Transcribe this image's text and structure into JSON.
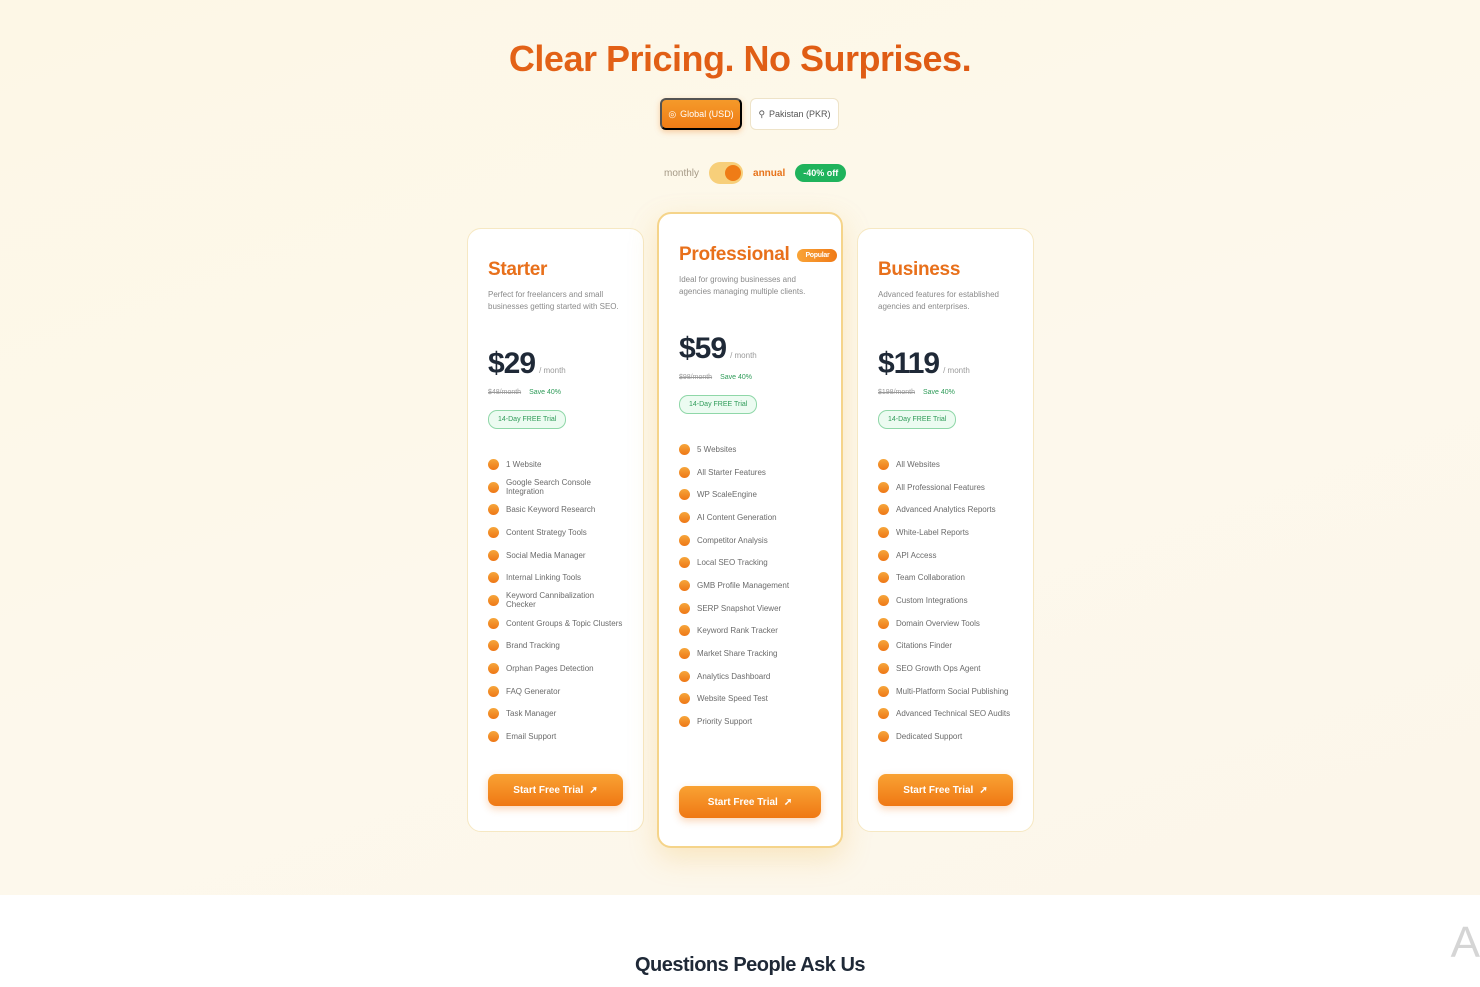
{
  "title": "Clear Pricing. No Surprises.",
  "regions": [
    {
      "label": "Global (USD)",
      "icon": "globe-icon"
    },
    {
      "label": "Pakistan (PKR)",
      "icon": "location-icon"
    }
  ],
  "billing": {
    "monthly": "monthly",
    "annual": "annual",
    "discount": "-40% off",
    "selected": "annual"
  },
  "colors": {
    "accent": "#ef7c16",
    "green": "#1fb35c",
    "title": "#e86a1b"
  },
  "plans": [
    {
      "name": "Starter",
      "desc": "Perfect for freelancers and small businesses getting started with SEO.",
      "price": "$29",
      "per": "/ month",
      "original": "$48/month",
      "save": "Save 40%",
      "trial": "14-Day FREE Trial",
      "features": [
        "1 Website",
        "Google Search Console Integration",
        "Basic Keyword Research",
        "Content Strategy Tools",
        "Social Media Manager",
        "Internal Linking Tools",
        "Keyword Cannibalization Checker",
        "Content Groups & Topic Clusters",
        "Brand Tracking",
        "Orphan Pages Detection",
        "FAQ Generator",
        "Task Manager",
        "Email Support"
      ],
      "cta": "Start Free Trial"
    },
    {
      "name": "Professional",
      "badge": "Popular",
      "desc": "Ideal for growing businesses and agencies managing multiple clients.",
      "price": "$59",
      "per": "/ month",
      "original": "$98/month",
      "save": "Save 40%",
      "trial": "14-Day FREE Trial",
      "features": [
        "5 Websites",
        "All Starter Features",
        "WP ScaleEngine",
        "AI Content Generation",
        "Competitor Analysis",
        "Local SEO Tracking",
        "GMB Profile Management",
        "SERP Snapshot Viewer",
        "Keyword Rank Tracker",
        "Market Share Tracking",
        "Analytics Dashboard",
        "Website Speed Test",
        "Priority Support"
      ],
      "cta": "Start Free Trial"
    },
    {
      "name": "Business",
      "desc": "Advanced features for established agencies and enterprises.",
      "price": "$119",
      "per": "/ month",
      "original": "$198/month",
      "save": "Save 40%",
      "trial": "14-Day FREE Trial",
      "features": [
        "All Websites",
        "All Professional Features",
        "Advanced Analytics Reports",
        "White-Label Reports",
        "API Access",
        "Team Collaboration",
        "Custom Integrations",
        "Domain Overview Tools",
        "Citations Finder",
        "SEO Growth Ops Agent",
        "Multi-Platform Social Publishing",
        "Advanced Technical SEO Audits",
        "Dedicated Support"
      ],
      "cta": "Start Free Trial"
    }
  ],
  "faq_title": "Questions People Ask Us",
  "side_letter": "A"
}
